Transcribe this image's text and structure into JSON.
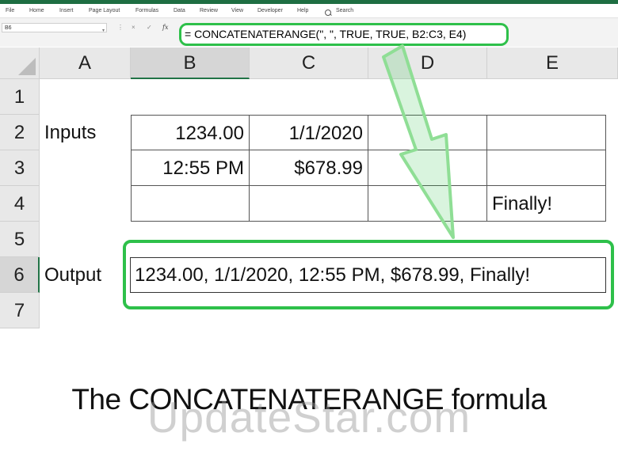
{
  "ribbon": {
    "accent_color": "#1e6e42",
    "tabs": [
      "File",
      "Home",
      "Insert",
      "Page Layout",
      "Formulas",
      "Data",
      "Review",
      "View",
      "Developer",
      "Help"
    ],
    "search_label": "Search"
  },
  "formula_bar": {
    "name_box": "B6",
    "cancel_icon": "×",
    "enter_icon": "✓",
    "fx_icon": "fx",
    "formula": "= CONCATENATERANGE(\", \", TRUE, TRUE, B2:C3, E4)",
    "highlight_color": "#2ec04a"
  },
  "grid": {
    "columns": [
      "A",
      "B",
      "C",
      "D",
      "E"
    ],
    "rows": [
      "1",
      "2",
      "3",
      "4",
      "5",
      "6",
      "7"
    ],
    "selected_cell": "B6",
    "cells": {
      "A2": "Inputs",
      "B2": "1234.00",
      "C2": "1/1/2020",
      "B3": "12:55 PM",
      "C3": "$678.99",
      "E4": "Finally!",
      "A6": "Output",
      "B6": "1234.00, 1/1/2020, 12:55 PM, $678.99, Finally!"
    }
  },
  "caption": "The CONCATENATERANGE formula",
  "watermark": "UpdateStar.com"
}
